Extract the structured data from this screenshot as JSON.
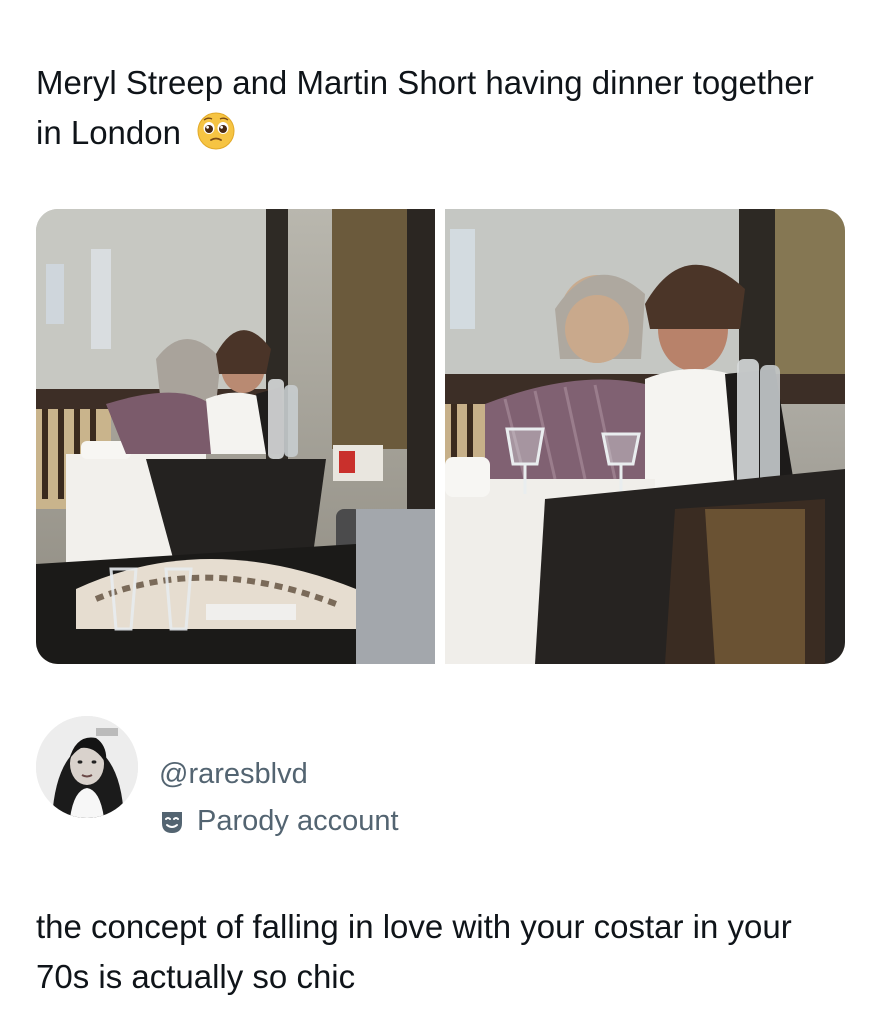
{
  "post": {
    "text": "Meryl Streep and Martin Short having dinner together in London",
    "emoji": "pleading-face-emoji"
  },
  "media": {
    "images": [
      {
        "name": "restaurant-photo-left"
      },
      {
        "name": "restaurant-photo-right"
      }
    ]
  },
  "account": {
    "handle": "@raresblvd",
    "label": "Parody account",
    "label_icon": "theater-masks-icon"
  },
  "reply": {
    "text": "the concept of falling in love with your costar in your 70s is actually so chic"
  },
  "colors": {
    "text": "#0f1419",
    "muted": "#536471",
    "emoji": "#f6c443"
  }
}
